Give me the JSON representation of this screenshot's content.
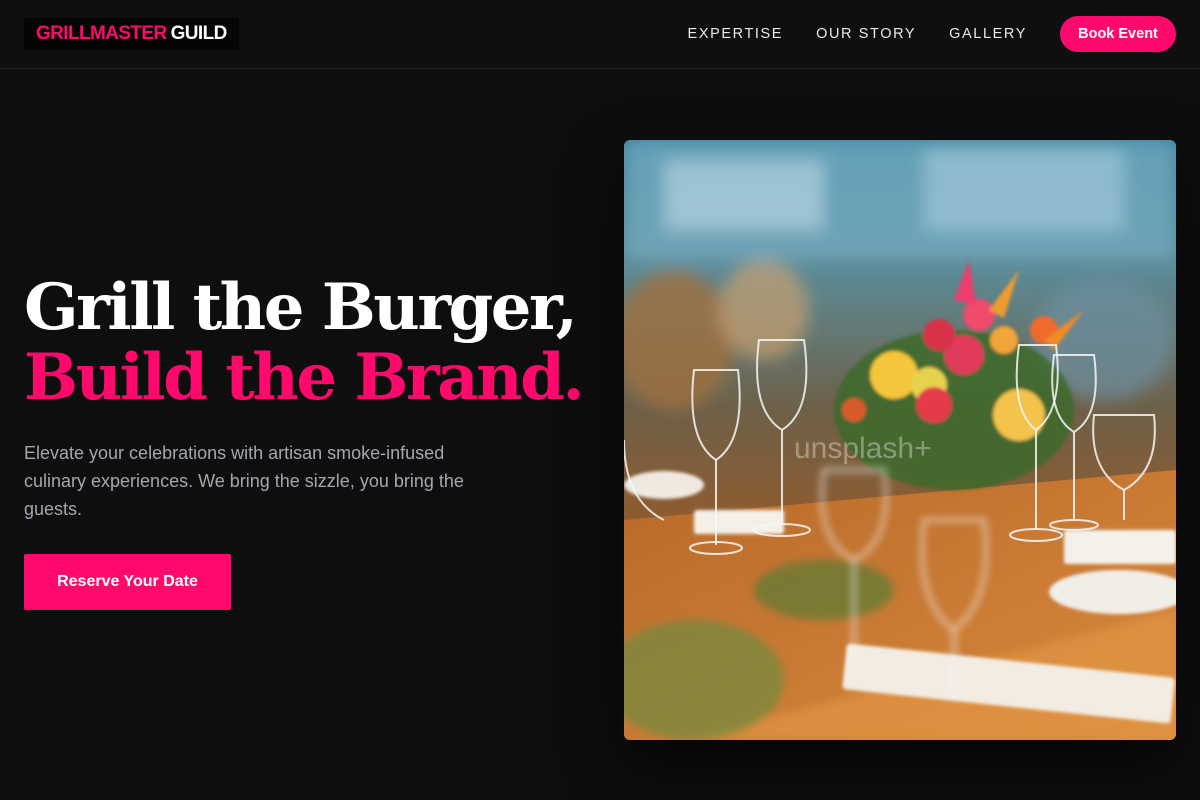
{
  "header": {
    "logo": {
      "part1": "GRILLMASTER",
      "part2": "GUILD"
    },
    "nav": [
      {
        "label": "EXPERTISE"
      },
      {
        "label": "OUR STORY"
      },
      {
        "label": "GALLERY"
      }
    ],
    "cta_label": "Book Event"
  },
  "hero": {
    "headline_line1": "Grill the Burger,",
    "headline_line2": "Build the Brand.",
    "description": "Elevate your celebrations with artisan smoke-infused culinary experiences. We bring the sizzle, you bring the guests.",
    "button_label": "Reserve Your Date",
    "image_watermark": "unsplash+"
  },
  "colors": {
    "background": "#0e0e0f",
    "accent": "#ff0a6c",
    "text": "#ffffff",
    "muted_text": "#a3a7b0"
  }
}
